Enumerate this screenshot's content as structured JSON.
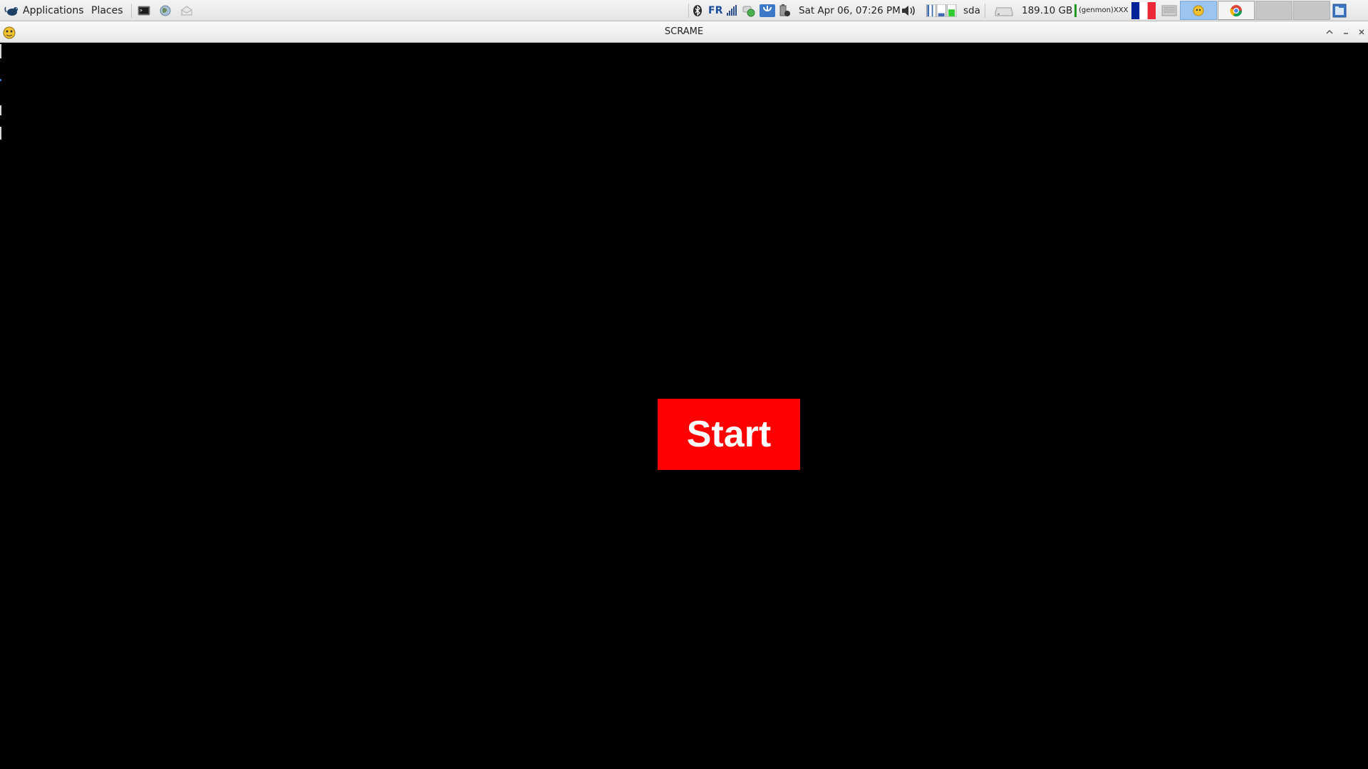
{
  "panel": {
    "applications_label": "Applications",
    "places_label": "Places",
    "keyboard_layout": "FR",
    "clock": "Sat Apr 06, 07:26 PM",
    "disk_name": "sda",
    "disk_free": "189.10 GB",
    "genmon_text": "(genmon)XXX",
    "launchers": [
      "terminal-icon",
      "web-browser-icon",
      "mail-icon"
    ],
    "tray_icons": [
      "bluetooth-icon",
      "network-signal-icon",
      "chat-icon",
      "updates-icon",
      "battery-icon",
      "volume-icon",
      "cpu-graph-icon",
      "drive-icon",
      "flag-fr-icon",
      "keyboard-icon"
    ],
    "taskbar": [
      "app-task-icon",
      "chrome-task-icon",
      "file-manager-icon"
    ]
  },
  "window": {
    "title": "SCRAME",
    "controls": [
      "maximize-icon",
      "minimize-icon",
      "close-icon"
    ]
  },
  "app": {
    "start_label": "Start",
    "start_color": "#ff0000",
    "background_color": "#000000"
  }
}
